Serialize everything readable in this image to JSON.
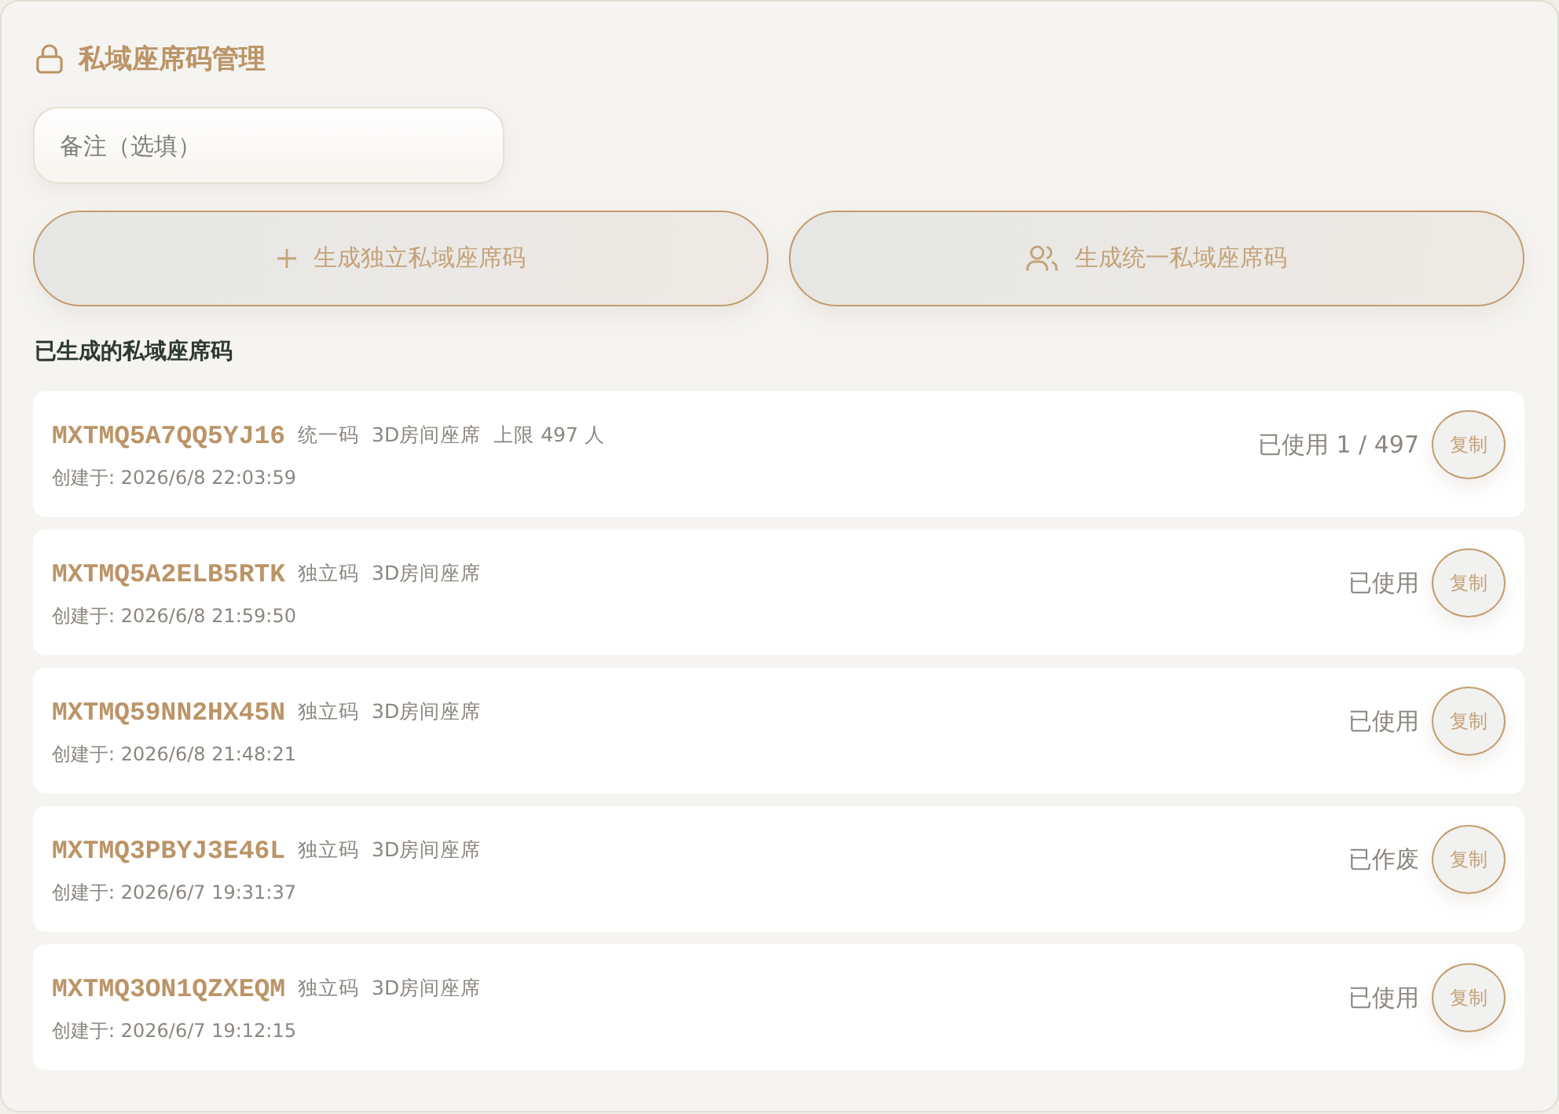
{
  "panel": {
    "title": "私域座席码管理"
  },
  "note_field": {
    "placeholder": "备注（选填）"
  },
  "actions": [
    {
      "kind": "plus",
      "label": "生成独立私域座席码"
    },
    {
      "kind": "users",
      "label": "生成统一私域座席码"
    }
  ],
  "list": {
    "heading": "已生成的私域座席码",
    "items": [
      {
        "code": "MXTMQ5A7QQ5YJ16",
        "tags": [
          "统一码",
          "3D房间座席",
          "上限 497 人"
        ],
        "created": "创建于: 2026/6/8 22:03:59",
        "status": "已使用 1 / 497",
        "copy_label": "复制"
      },
      {
        "code": "MXTMQ5A2ELB5RTK",
        "tags": [
          "独立码",
          "3D房间座席"
        ],
        "created": "创建于: 2026/6/8 21:59:50",
        "status": "已使用",
        "copy_label": "复制"
      },
      {
        "code": "MXTMQ59NN2HX45N",
        "tags": [
          "独立码",
          "3D房间座席"
        ],
        "created": "创建于: 2026/6/8 21:48:21",
        "status": "已使用",
        "copy_label": "复制"
      },
      {
        "code": "MXTMQ3PBYJ3E46L",
        "tags": [
          "独立码",
          "3D房间座席"
        ],
        "created": "创建于: 2026/6/7 19:31:37",
        "status": "已作废",
        "copy_label": "复制"
      },
      {
        "code": "MXTMQ3ON1QZXEQM",
        "tags": [
          "独立码",
          "3D房间座席"
        ],
        "created": "创建于: 2026/6/7 19:12:15",
        "status": "已使用",
        "copy_label": "复制"
      }
    ]
  }
}
